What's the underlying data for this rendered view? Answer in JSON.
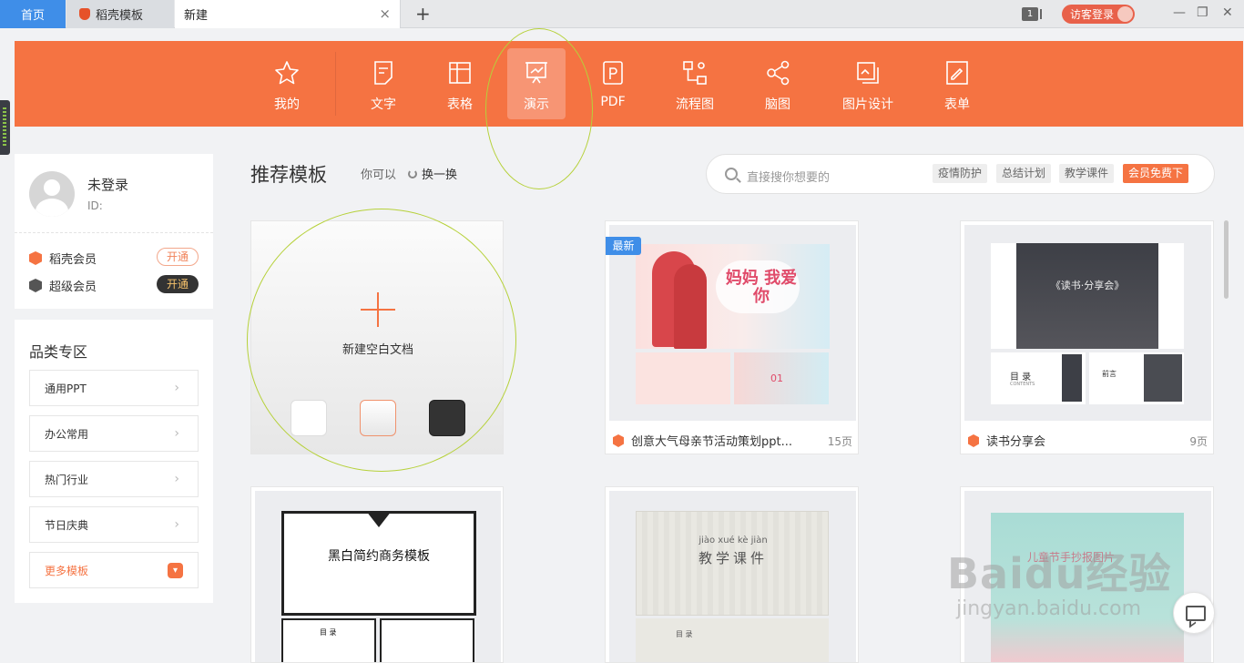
{
  "tabs": {
    "home": "首页",
    "templates": "稻壳模板",
    "new": "新建",
    "close": "×",
    "add": "+"
  },
  "window": {
    "badge": "1",
    "visitor_login": "访客登录",
    "minimize": "—",
    "restore": "❐",
    "close": "✕"
  },
  "toolbar": {
    "items": [
      {
        "label": "我的",
        "icon": "star-icon"
      },
      {
        "label": "文字",
        "icon": "document-icon"
      },
      {
        "label": "表格",
        "icon": "table-icon"
      },
      {
        "label": "演示",
        "icon": "presentation-icon"
      },
      {
        "label": "PDF",
        "icon": "pdf-icon"
      },
      {
        "label": "流程图",
        "icon": "flowchart-icon"
      },
      {
        "label": "脑图",
        "icon": "mindmap-icon"
      },
      {
        "label": "图片设计",
        "icon": "image-design-icon"
      },
      {
        "label": "表单",
        "icon": "form-icon"
      }
    ],
    "active": "演示",
    "accent": "#f57342"
  },
  "profile": {
    "name": "未登录",
    "id_label": "ID:",
    "memberships": [
      {
        "label": "稻壳会员",
        "button": "开通"
      },
      {
        "label": "超级会员",
        "button": "开通"
      }
    ]
  },
  "categories": {
    "title": "品类专区",
    "items": [
      "通用PPT",
      "办公常用",
      "热门行业",
      "节日庆典"
    ],
    "more": "更多模板"
  },
  "recommend": {
    "title": "推荐模板",
    "subtitle": "你可以",
    "refresh": "换一换"
  },
  "search": {
    "placeholder": "直接搜你想要的",
    "tags": [
      "疫情防护",
      "总结计划",
      "教学课件"
    ],
    "vip_tag": "会员免费下"
  },
  "blank": {
    "label": "新建空白文档"
  },
  "cards": [
    {
      "badge": "最新",
      "title": "创意大气母亲节活动策划ppt...",
      "pages": "15页",
      "thumb_main": "妈妈 我爱你",
      "thumb_sub": "01"
    },
    {
      "title": "读书分享会",
      "pages": "9页",
      "thumb_main": "《读书·分享会》",
      "thumb_sub": "目 录",
      "thumb_sub2": "CONTENTS",
      "thumb_sub3": "前言"
    },
    {
      "thumb_main": "黑白简约商务模板",
      "thumb_sub": "目 录"
    },
    {
      "thumb_pinyin": "jiào  xué  kè  jiàn",
      "thumb_main": "教学课件",
      "thumb_sub": "目 录"
    },
    {
      "thumb_main": "儿童节手抄报图片"
    }
  ],
  "watermark": {
    "line1": "Baidu经验",
    "line2": "jingyan.baidu.com"
  }
}
